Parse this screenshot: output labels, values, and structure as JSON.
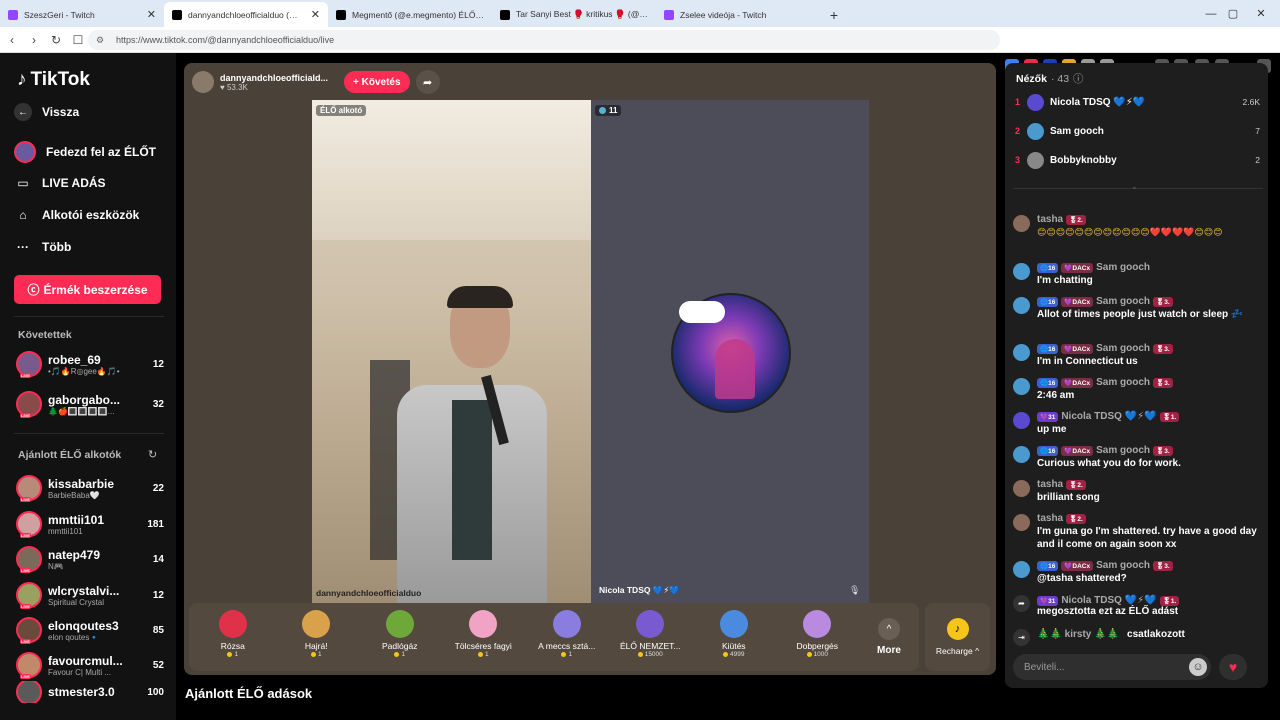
{
  "browser": {
    "tabs": [
      {
        "label": "SzeszGeri - Twitch",
        "color": "#9146ff"
      },
      {
        "label": "dannyandchloeofficialduo (@dan",
        "color": "#000000",
        "active": true
      },
      {
        "label": "Megmentő (@e.megmento) ÉLŐ adá",
        "color": "#000000"
      },
      {
        "label": "Tar Sanyi Best 🥊 kritikus 🥊 (@szop",
        "color": "#000000"
      },
      {
        "label": "Zselee videója - Twitch",
        "color": "#9146ff"
      }
    ],
    "url": "https://www.tiktok.com/@dannyandchloeofficialduo/live"
  },
  "sidebar": {
    "logo": "TikTok",
    "back": "Vissza",
    "nav": [
      {
        "label": "Fedezd fel az ÉLŐT",
        "icon": "explore-avatar-icon"
      },
      {
        "label": "LIVE ADÁS",
        "icon": "camera-icon"
      },
      {
        "label": "Alkotói eszközök",
        "icon": "home-icon"
      },
      {
        "label": "Több",
        "icon": "more-icon"
      }
    ],
    "coins_button": "Érmék beszerzése",
    "followed_heading": "Követettek",
    "followed": [
      {
        "name": "robee_69",
        "sub": "•🎵🔥R◎ɡee🔥🎵•",
        "count": "12"
      },
      {
        "name": "gaborgabo...",
        "sub": "🌲🍎🔳🔳🔳🔳...",
        "count": "32"
      }
    ],
    "recommended_heading": "Ajánlott ÉLŐ alkotók",
    "recommended": [
      {
        "name": "kissabarbie",
        "sub": "BarbieBaba🤍",
        "count": "22"
      },
      {
        "name": "mmttii101",
        "sub": "mmttii101",
        "count": "181"
      },
      {
        "name": "natep479",
        "sub": "N🎮",
        "count": "14"
      },
      {
        "name": "wlcrystalvi...",
        "sub": "Spiritual Crystal",
        "count": "12"
      },
      {
        "name": "elonqoutes3",
        "sub": "elon qoutes🔹",
        "count": "85"
      },
      {
        "name": "favourcmul...",
        "sub": "Favour C| Multi ...",
        "count": "52"
      },
      {
        "name": "stmester3.0",
        "sub": "",
        "count": "100"
      }
    ]
  },
  "stream": {
    "streamer_name": "dannyandchloeofficiald...",
    "likes": "53.3K",
    "follow_label": "+ Követés",
    "left_badge": "ÉLŐ alkotó",
    "left_label": "dannyandchloeofficialduo",
    "right_count": "11",
    "right_label": "Nicola TDSQ 💙⚡💙"
  },
  "gifts": [
    {
      "name": "Rózsa",
      "price": "1",
      "color": "#e0314b"
    },
    {
      "name": "Hajrá!",
      "price": "1",
      "color": "#d9a24a"
    },
    {
      "name": "Padlógáz",
      "price": "1",
      "color": "#6fa83a"
    },
    {
      "name": "Tölcséres fagyi",
      "price": "1",
      "color": "#f0a3c4"
    },
    {
      "name": "A meccs sztá...",
      "price": "1",
      "color": "#8a7de0"
    },
    {
      "name": "ÉLŐ NEMZET...",
      "price": "15000",
      "color": "#7a5ad0"
    },
    {
      "name": "Kiütés",
      "price": "4999",
      "color": "#4a8be0"
    },
    {
      "name": "Dobpergés",
      "price": "1000",
      "color": "#b98ae0"
    }
  ],
  "more_label": "More",
  "recharge_label": "Recharge ^",
  "recommended_streams_heading": "Ajánlott ÉLŐ adások",
  "chat": {
    "viewers_heading": "Nézők",
    "viewers_count": "· 43",
    "top_viewers": [
      {
        "rank": "1",
        "name": "Nicola TDSQ 💙⚡💙",
        "score": "2.6K",
        "color": "#5a4ad0"
      },
      {
        "rank": "2",
        "name": "Sam gooch",
        "score": "7",
        "color": "#4a9ad0"
      },
      {
        "rank": "3",
        "name": "Bobbyknobby",
        "score": "2",
        "color": "#888888"
      }
    ],
    "messages": [
      {
        "user": "tasha",
        "badges": [
          "🎖2."
        ],
        "text": "😊😊😊😊😊😊😊😊😊😊😊😊❤️❤️❤️❤️😊😊😊",
        "avatar": "#8a6a5a"
      },
      {
        "user": "Sam gooch",
        "badges": [
          "🌐16",
          "💜DACx"
        ],
        "text": "I'm chatting",
        "avatar": "#4a9ad0"
      },
      {
        "user": "Sam gooch",
        "badges": [
          "🌐16",
          "💜DACx",
          "🎖3."
        ],
        "text": "Allot of times people just watch or sleep 💤",
        "avatar": "#4a9ad0"
      },
      {
        "user": "Sam gooch",
        "badges": [
          "🌐16",
          "💜DACx",
          "🎖3."
        ],
        "text": "I'm in Connecticut us",
        "avatar": "#4a9ad0"
      },
      {
        "user": "Sam gooch",
        "badges": [
          "🌐16",
          "💜DACx",
          "🎖3."
        ],
        "text": "2:46 am",
        "avatar": "#4a9ad0"
      },
      {
        "user": "Nicola TDSQ 💙⚡💙",
        "badges": [
          "💜31",
          "🎖1."
        ],
        "text": "up me",
        "avatar": "#5a4ad0"
      },
      {
        "user": "Sam gooch",
        "badges": [
          "🌐16",
          "💜DACx",
          "🎖3."
        ],
        "text": "Curious what you do for work.",
        "avatar": "#4a9ad0"
      },
      {
        "user": "tasha",
        "badges": [
          "🎖2."
        ],
        "text": "brilliant song",
        "avatar": "#8a6a5a"
      },
      {
        "user": "tasha",
        "badges": [
          "🎖2."
        ],
        "text": "I'm guna go I'm shattered. try have a good day and il come on again soon xx",
        "avatar": "#8a6a5a"
      },
      {
        "user": "Sam gooch",
        "badges": [
          "🌐16",
          "💜DACx",
          "🎖3."
        ],
        "text": "@tasha shattered?",
        "avatar": "#4a9ad0"
      }
    ],
    "share_event": {
      "user": "Nicola TDSQ 💙⚡💙",
      "badges": [
        "💜31",
        "🎖1."
      ],
      "text": "megosztotta ezt az ÉLŐ adást"
    },
    "join_event": {
      "user": "🎄🎄 kirsty 🎄🎄",
      "text": "csatlakozott"
    },
    "input_placeholder": "Beviteli..."
  }
}
